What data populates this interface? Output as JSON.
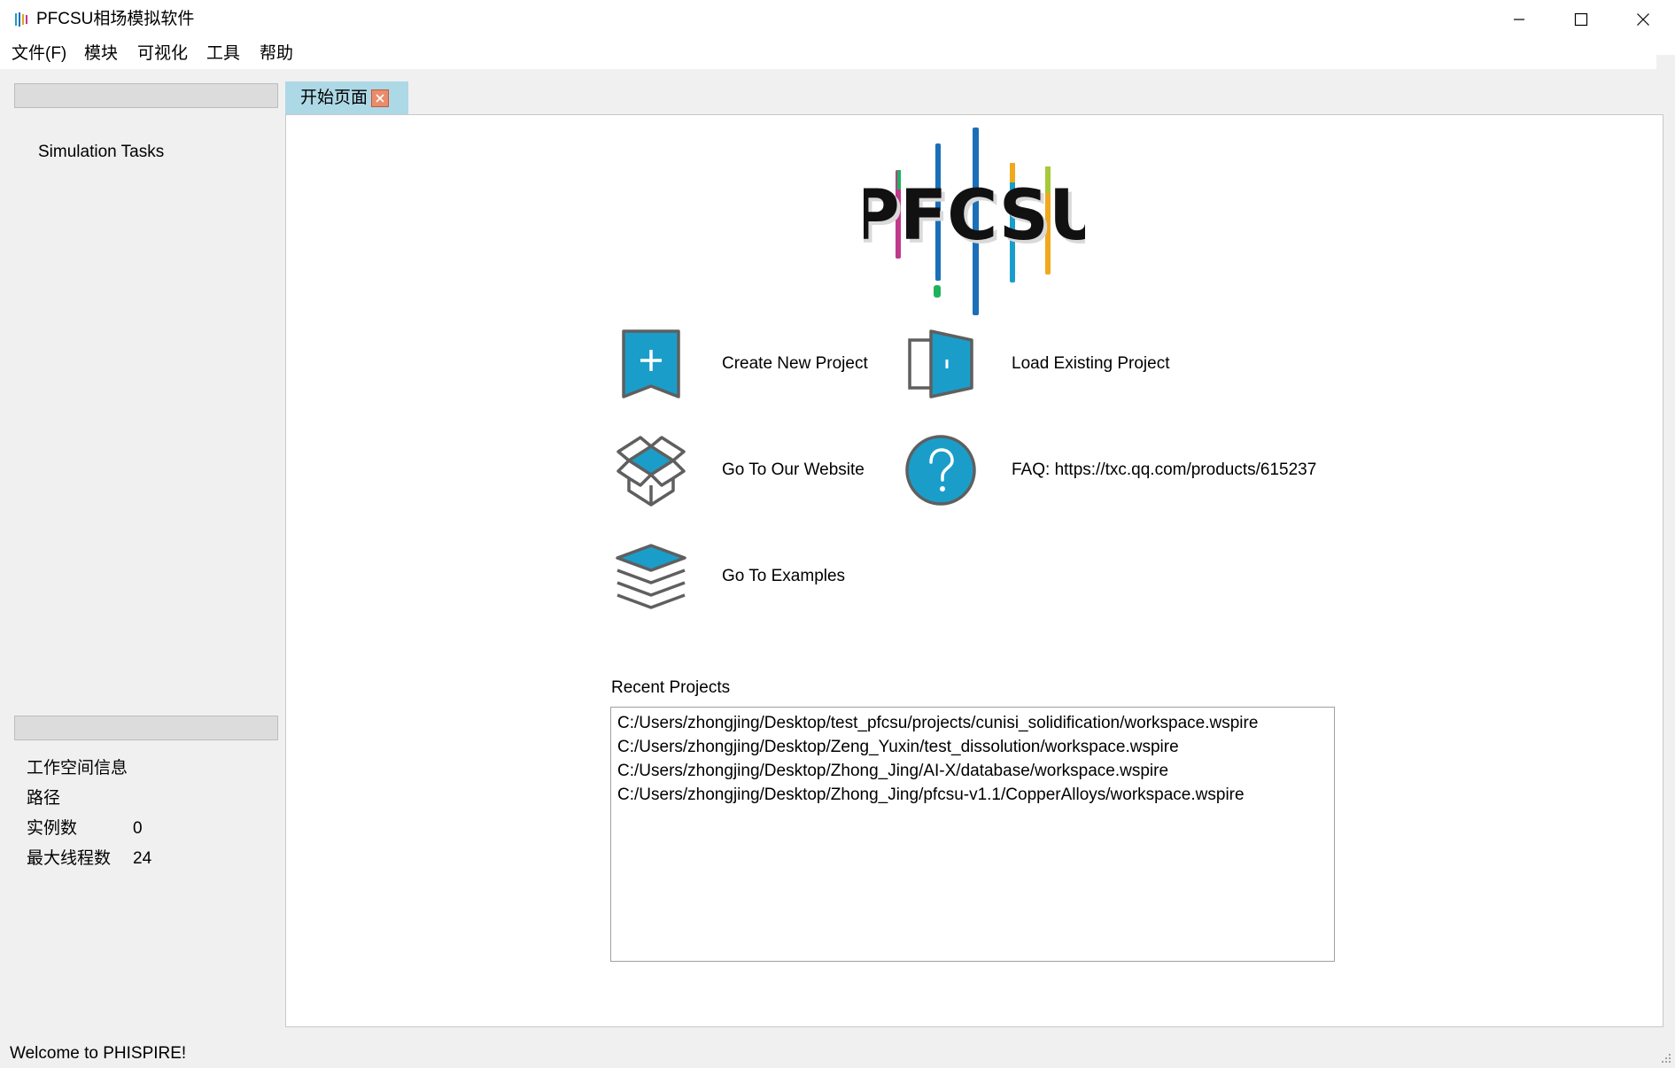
{
  "window": {
    "title": "PFCSU相场模拟软件",
    "app_icon": "pfcsu-app-icon",
    "controls": [
      "minimize-icon",
      "maximize-icon",
      "close-icon"
    ]
  },
  "menubar": {
    "items": [
      "文件(F)",
      "模块",
      "可视化",
      "工具",
      "帮助"
    ]
  },
  "left_panel": {
    "tasks_title": "Simulation Tasks",
    "workspace": {
      "heading": "工作空间信息",
      "path_label": "路径",
      "path_value": "",
      "instances_label": "实例数",
      "instances_value": "0",
      "threads_label": "最大线程数",
      "threads_value": "24"
    }
  },
  "tabs": [
    {
      "label": "开始页面",
      "active": true,
      "close_icon": "tab-close-icon"
    }
  ],
  "start_page": {
    "logo_text": "PFCSU",
    "actions": {
      "create_label": "Create New Project",
      "load_label": "Load Existing Project",
      "website_label": "Go To Our Website",
      "faq_label": "FAQ: https://txc.qq.com/products/615237",
      "examples_label": "Go To Examples"
    },
    "recent_title": "Recent Projects",
    "recent_projects": [
      "C:/Users/zhongjing/Desktop/test_pfcsu/projects/cunisi_solidification/workspace.wspire",
      "C:/Users/zhongjing/Desktop/Zeng_Yuxin/test_dissolution/workspace.wspire",
      "C:/Users/zhongjing/Desktop/Zhong_Jing/AI-X/database/workspace.wspire",
      "C:/Users/zhongjing/Desktop/Zhong_Jing/pfcsu-v1.1/CopperAlloys/workspace.wspire"
    ]
  },
  "statusbar": {
    "message": "Welcome to PHISPIRE!"
  },
  "colors": {
    "accent": "#1a9ec9",
    "icon_outline": "#5f5f5f",
    "tab_active": "#add8e6",
    "tab_close": "#e98c6c"
  }
}
